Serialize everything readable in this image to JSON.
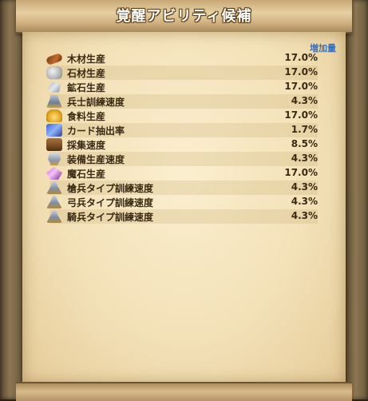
{
  "window": {
    "title": "覚醒アビリティ候補"
  },
  "table": {
    "column_header": "増加量",
    "rows": [
      {
        "icon": "wood-icon",
        "name": "木材生産",
        "value": "17.0%"
      },
      {
        "icon": "stone-icon",
        "name": "石材生産",
        "value": "17.0%"
      },
      {
        "icon": "ore-icon",
        "name": "鉱石生産",
        "value": "17.0%"
      },
      {
        "icon": "soldier-icon",
        "name": "兵士訓練速度",
        "value": "4.3%"
      },
      {
        "icon": "food-icon",
        "name": "食料生産",
        "value": "17.0%"
      },
      {
        "icon": "card-icon",
        "name": "カード抽出率",
        "value": "1.7%"
      },
      {
        "icon": "gather-icon",
        "name": "採集速度",
        "value": "8.5%"
      },
      {
        "icon": "equipment-icon",
        "name": "装備生産速度",
        "value": "4.3%"
      },
      {
        "icon": "magic-stone-icon",
        "name": "魔石生産",
        "value": "17.0%"
      },
      {
        "icon": "spearman-icon",
        "name": "槍兵タイプ訓練速度",
        "value": "4.3%"
      },
      {
        "icon": "archer-icon",
        "name": "弓兵タイプ訓練速度",
        "value": "4.3%"
      },
      {
        "icon": "cavalry-icon",
        "name": "騎兵タイプ訓練速度",
        "value": "4.3%"
      }
    ]
  },
  "colors": {
    "header_blue": "#3b6fb5",
    "text_brown": "#3a2a14",
    "parchment": "#f3e1b8"
  }
}
